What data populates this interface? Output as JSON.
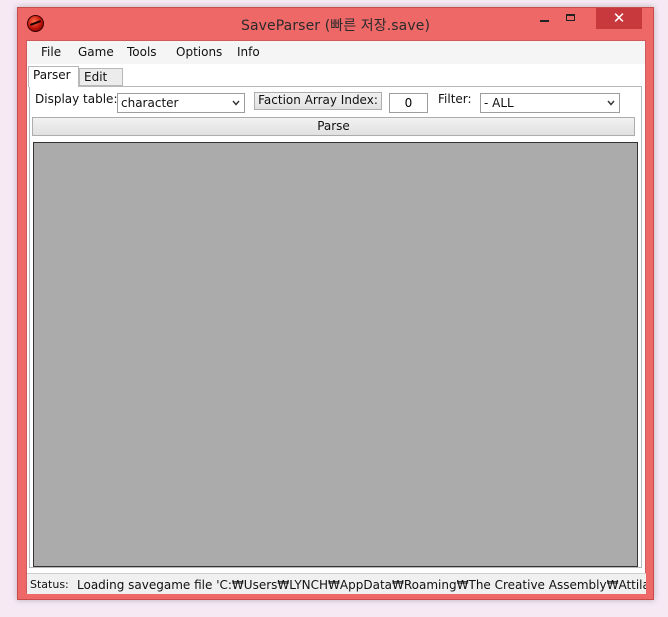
{
  "window": {
    "title": "SaveParser (빠른 저장.save)",
    "close_glyph": "✕"
  },
  "menu": {
    "items": [
      "File",
      "Game",
      "Tools",
      "Options",
      "Info"
    ]
  },
  "tabs": [
    {
      "label": "Parser",
      "active": true
    },
    {
      "label": "Edit",
      "active": false
    }
  ],
  "parser": {
    "display_table_label": "Display table:",
    "display_table_value": "character",
    "faction_button_label": "Faction Array Index:",
    "faction_index_value": "0",
    "filter_label": "Filter:",
    "filter_value": "- ALL",
    "parse_button_label": "Parse"
  },
  "status": {
    "label": "Status:",
    "text": "Loading savegame file 'C:₩Users₩LYNCH₩AppData₩Roaming₩The Creative Assembly₩Attila₩save_games₩빠른 저장.save'"
  },
  "colors": {
    "window_frame": "#ef6868",
    "close_button": "#c7393c",
    "grid_background": "#ababab"
  },
  "icons": {
    "app": "red-globe-icon",
    "dropdown": "chevron-down-icon"
  }
}
